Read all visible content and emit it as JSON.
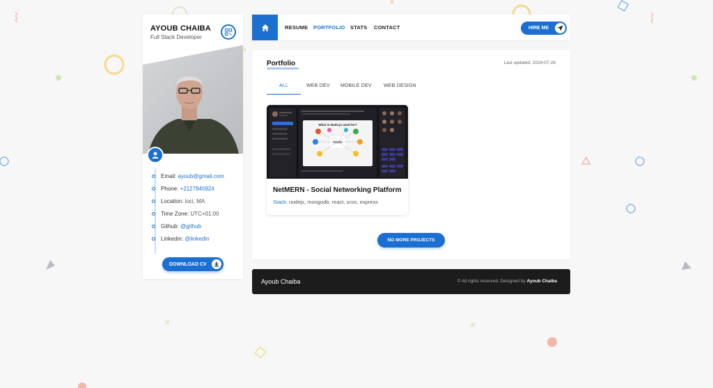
{
  "sidebar": {
    "name": "AYOUB CHAIBA",
    "role": "Full Stack Developer",
    "info": [
      {
        "label": "Email:",
        "value": "ayoub@gmail.com",
        "link": true
      },
      {
        "label": "Phone:",
        "value": "+2127845924",
        "link": true
      },
      {
        "label": "Location:",
        "value": "loci, MA",
        "link": false
      },
      {
        "label": "Time Zone:",
        "value": "UTC+01:00",
        "link": false
      },
      {
        "label": "Github:",
        "value": "@github",
        "link": true
      },
      {
        "label": "Linkedin:",
        "value": "@linkedin",
        "link": true
      }
    ],
    "download_label": "DOWNLOAD CV"
  },
  "nav": {
    "items": [
      "RESUME",
      "PORTFOLIO",
      "STATS",
      "CONTACT"
    ],
    "active": "PORTFOLIO",
    "hire_label": "HIRE ME"
  },
  "portfolio": {
    "title": "Portfolio",
    "updated": "Last updated: 2024-07-26",
    "tabs": [
      "ALL",
      "WEB DEV",
      "MOBILE DEV",
      "WEB DESIGN"
    ],
    "active_tab": "ALL",
    "projects": [
      {
        "title": "NetMERN - Social Networking Platform",
        "stack_label": "Stack:",
        "stack": "nodejs, mongodb, react, scss, express",
        "thumb_heading": "What is Node.js used for?",
        "thumb_logo": "node"
      }
    ],
    "more_label": "NO MORE PROJECTS"
  },
  "footer": {
    "name": "Ayoub Chaiba",
    "copyright": "© All rights reserved. Designed by",
    "designer": "Ayoub Chaiba"
  },
  "colors": {
    "accent": "#1a6fd0",
    "footer_bg": "#1c1c1c",
    "page_bg": "#f7f7f7"
  }
}
